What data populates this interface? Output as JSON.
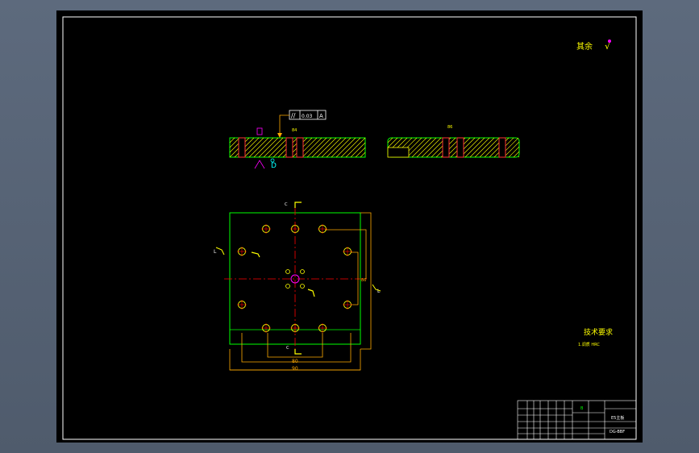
{
  "annotations": {
    "other_surfaces": "其余",
    "tech_requirements_title": "技术要求",
    "tech_requirements_item": "1.调质 HRC",
    "tolerance_parallel": "//",
    "tolerance_value": "0.03",
    "datum_letter": "A",
    "datum_mark": "D",
    "roughness_mark": "√",
    "section_mark_top": "C",
    "section_mark_bottom": "C",
    "section_mark_left": "L",
    "section_mark_right": "L",
    "dim_label_1": "84",
    "dim_label_2": "86",
    "dim_bottom": "80",
    "dim_bottom_2": "90",
    "dim_right": "86"
  },
  "title_block": {
    "drawing_title": "E5主板",
    "drawing_code": "DG-BBF",
    "material": "B",
    "cells": [
      "标记",
      "处数",
      "分区",
      "更改文件号",
      "签名",
      "年月日",
      "设计",
      "标准化",
      "阶段标记",
      "重量",
      "比例",
      "审核",
      "工艺",
      "批准",
      "共张",
      "第张"
    ]
  },
  "colors": {
    "background": "#000000",
    "border": "#ffffff",
    "outline": "#00ff00",
    "hatch": "#ffff00",
    "dimension": "#ffaa00",
    "centerline": "#ff0000",
    "annotation": "#ffff00",
    "magenta": "#ff00ff",
    "cyan": "#00ffff"
  }
}
